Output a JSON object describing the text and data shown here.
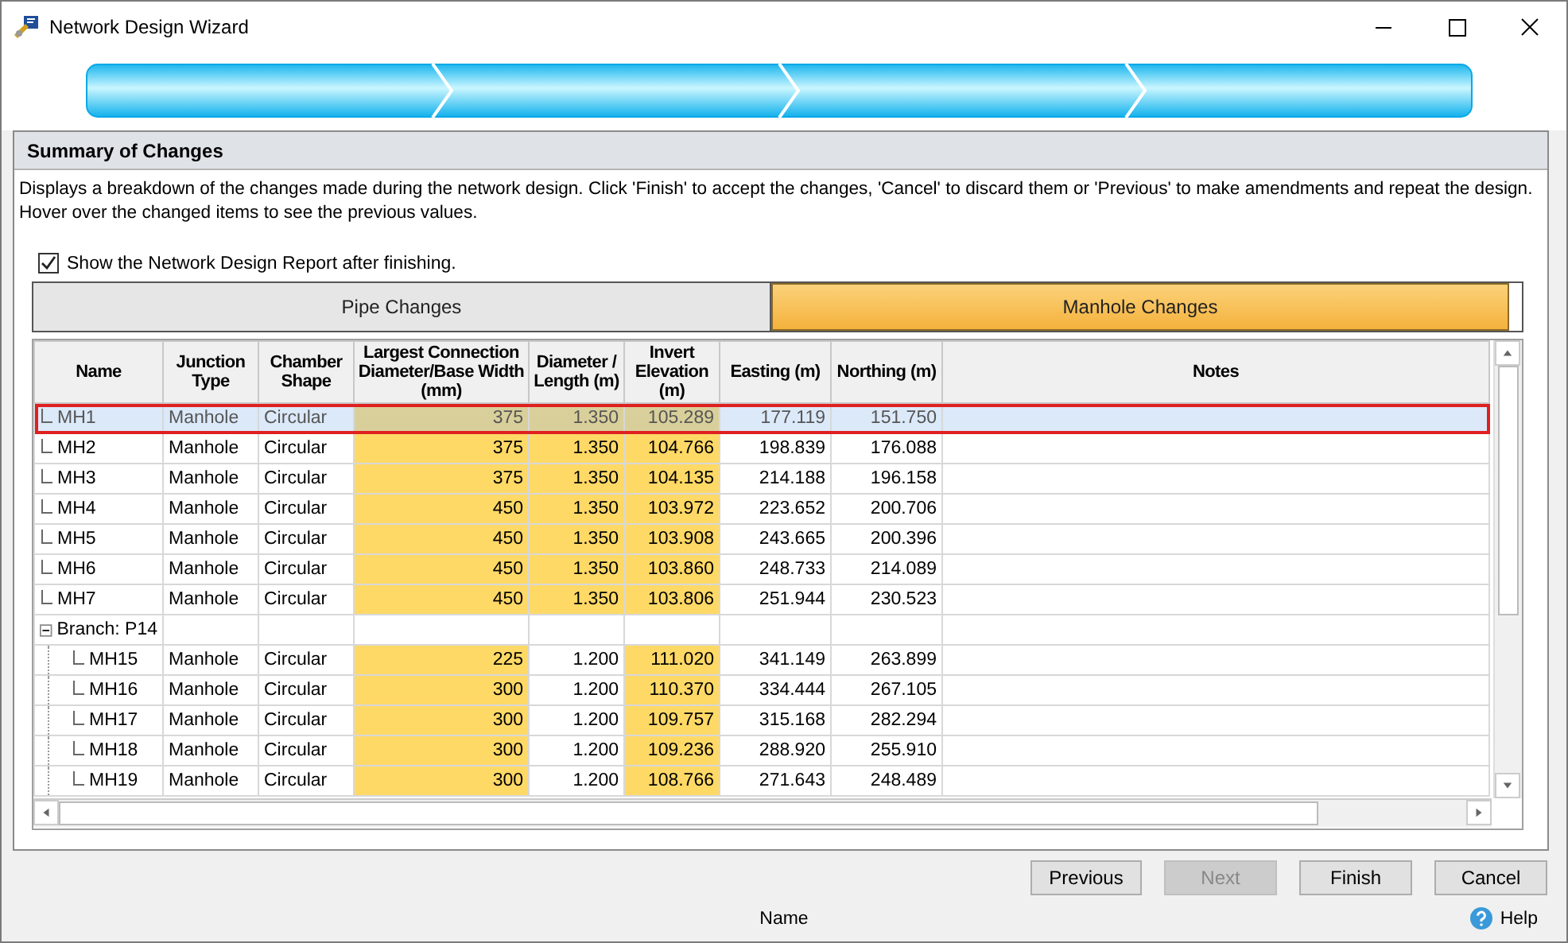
{
  "window": {
    "title": "Network Design Wizard"
  },
  "section": {
    "title": "Summary of Changes",
    "description": "Displays a breakdown of the changes made during the network design. Click 'Finish' to accept the changes, 'Cancel' to discard them or 'Previous' to make amendments and repeat the design. Hover over the changed items to see the previous values."
  },
  "show_report": {
    "label": "Show the Network Design Report after finishing.",
    "checked": true
  },
  "tabs": [
    {
      "label": "Pipe Changes",
      "selected": false
    },
    {
      "label": "Manhole Changes",
      "selected": true
    }
  ],
  "table": {
    "columns": [
      "Name",
      "Junction Type",
      "Chamber Shape",
      "Largest Connection Diameter/Base Width (mm)",
      "Diameter / Length (m)",
      "Invert Elevation (m)",
      "Easting (m)",
      "Northing (m)",
      "Notes"
    ],
    "rows": [
      {
        "kind": "node",
        "name": "MH1",
        "selected": true,
        "cells": [
          "Manhole",
          "Circular",
          "375",
          "1.350",
          "105.289",
          "177.119",
          "151.750"
        ],
        "changed": [
          false,
          false,
          true,
          true,
          true,
          false,
          false
        ]
      },
      {
        "kind": "node",
        "name": "MH2",
        "selected": false,
        "cells": [
          "Manhole",
          "Circular",
          "375",
          "1.350",
          "104.766",
          "198.839",
          "176.088"
        ],
        "changed": [
          false,
          false,
          true,
          true,
          true,
          false,
          false
        ]
      },
      {
        "kind": "node",
        "name": "MH3",
        "selected": false,
        "cells": [
          "Manhole",
          "Circular",
          "375",
          "1.350",
          "104.135",
          "214.188",
          "196.158"
        ],
        "changed": [
          false,
          false,
          true,
          true,
          true,
          false,
          false
        ]
      },
      {
        "kind": "node",
        "name": "MH4",
        "selected": false,
        "cells": [
          "Manhole",
          "Circular",
          "450",
          "1.350",
          "103.972",
          "223.652",
          "200.706"
        ],
        "changed": [
          false,
          false,
          true,
          true,
          true,
          false,
          false
        ]
      },
      {
        "kind": "node",
        "name": "MH5",
        "selected": false,
        "cells": [
          "Manhole",
          "Circular",
          "450",
          "1.350",
          "103.908",
          "243.665",
          "200.396"
        ],
        "changed": [
          false,
          false,
          true,
          true,
          true,
          false,
          false
        ]
      },
      {
        "kind": "node",
        "name": "MH6",
        "selected": false,
        "cells": [
          "Manhole",
          "Circular",
          "450",
          "1.350",
          "103.860",
          "248.733",
          "214.089"
        ],
        "changed": [
          false,
          false,
          true,
          true,
          true,
          false,
          false
        ]
      },
      {
        "kind": "node",
        "name": "MH7",
        "selected": false,
        "cells": [
          "Manhole",
          "Circular",
          "450",
          "1.350",
          "103.806",
          "251.944",
          "230.523"
        ],
        "changed": [
          false,
          false,
          true,
          true,
          true,
          false,
          false
        ]
      },
      {
        "kind": "branch",
        "name": "Branch: P14",
        "expanded": true,
        "children": [
          {
            "kind": "node",
            "name": "MH15",
            "selected": false,
            "cells": [
              "Manhole",
              "Circular",
              "225",
              "1.200",
              "111.020",
              "341.149",
              "263.899"
            ],
            "changed": [
              false,
              false,
              true,
              false,
              true,
              false,
              false
            ]
          },
          {
            "kind": "node",
            "name": "MH16",
            "selected": false,
            "cells": [
              "Manhole",
              "Circular",
              "300",
              "1.200",
              "110.370",
              "334.444",
              "267.105"
            ],
            "changed": [
              false,
              false,
              true,
              false,
              true,
              false,
              false
            ]
          },
          {
            "kind": "node",
            "name": "MH17",
            "selected": false,
            "cells": [
              "Manhole",
              "Circular",
              "300",
              "1.200",
              "109.757",
              "315.168",
              "282.294"
            ],
            "changed": [
              false,
              false,
              true,
              false,
              true,
              false,
              false
            ]
          },
          {
            "kind": "node",
            "name": "MH18",
            "selected": false,
            "cells": [
              "Manhole",
              "Circular",
              "300",
              "1.200",
              "109.236",
              "288.920",
              "255.910"
            ],
            "changed": [
              false,
              false,
              true,
              false,
              true,
              false,
              false
            ]
          },
          {
            "kind": "node",
            "name": "MH19",
            "selected": false,
            "cells": [
              "Manhole",
              "Circular",
              "300",
              "1.200",
              "108.766",
              "271.643",
              "248.489"
            ],
            "changed": [
              false,
              false,
              true,
              false,
              true,
              false,
              false
            ]
          }
        ]
      }
    ]
  },
  "buttons": [
    {
      "label": "Previous",
      "disabled": false
    },
    {
      "label": "Next",
      "disabled": true
    },
    {
      "label": "Finish",
      "disabled": false
    },
    {
      "label": "Cancel",
      "disabled": false
    }
  ],
  "status_bar": {
    "text": "Name",
    "help": "Help"
  }
}
